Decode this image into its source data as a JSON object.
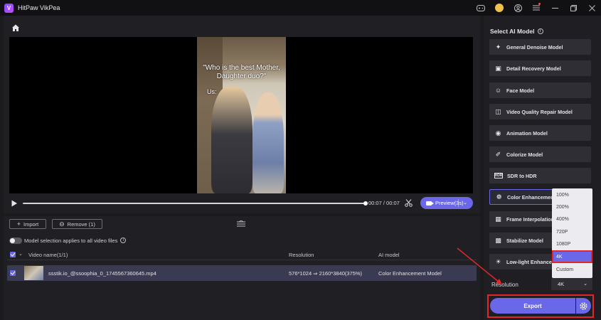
{
  "window": {
    "title": "HitPaw VikPea",
    "logo_letter": "V"
  },
  "player": {
    "caption": "\"Who is the best Mother, Daughter duo?\"",
    "caption_sub": "Us:",
    "time": "00:07 / 00:07",
    "preview_label": "Preview(3s)",
    "progress_fraction": 1.0
  },
  "toolbar": {
    "import_label": "Import",
    "remove_label": "Remove (1)"
  },
  "toggle": {
    "label": "Model selection applies to all video files"
  },
  "file_list": {
    "headers": {
      "name": "Video name(1/1)",
      "resolution": "Resolution",
      "ai_model": "AI model"
    },
    "rows": [
      {
        "name": "ssstik.io_@ssoophia_0_1745567360645.mp4",
        "resolution_from": "576*1024",
        "resolution_to": "2160*3840(375%)",
        "ai_model": "Color Enhancement Model"
      }
    ]
  },
  "models": {
    "title": "Select AI Model",
    "items": [
      {
        "label": "General Denoise Model",
        "icon": "denoise-icon"
      },
      {
        "label": "Detail Recovery Model",
        "icon": "detail-icon"
      },
      {
        "label": "Face Model",
        "icon": "face-icon"
      },
      {
        "label": "Video Quality Repair Model",
        "icon": "repair-icon"
      },
      {
        "label": "Animation Model",
        "icon": "animation-icon"
      },
      {
        "label": "Colorize Model",
        "icon": "colorize-icon"
      },
      {
        "label": "SDR to HDR",
        "icon": "hdr-icon"
      },
      {
        "label": "Color Enhancement",
        "icon": "palette-icon"
      },
      {
        "label": "Frame Interpolation",
        "icon": "frame-icon"
      },
      {
        "label": "Stabilize Model",
        "icon": "stabilize-icon"
      },
      {
        "label": "Low-light Enhancement",
        "icon": "lowlight-icon"
      }
    ],
    "active_index": 7
  },
  "resolution": {
    "label": "Resolution",
    "selected": "4K",
    "options": [
      "100%",
      "200%",
      "400%",
      "720P",
      "1080P",
      "4K",
      "Custom"
    ]
  },
  "export": {
    "label": "Export"
  },
  "colors": {
    "accent": "#6a67e8",
    "highlight": "#e0272b"
  }
}
